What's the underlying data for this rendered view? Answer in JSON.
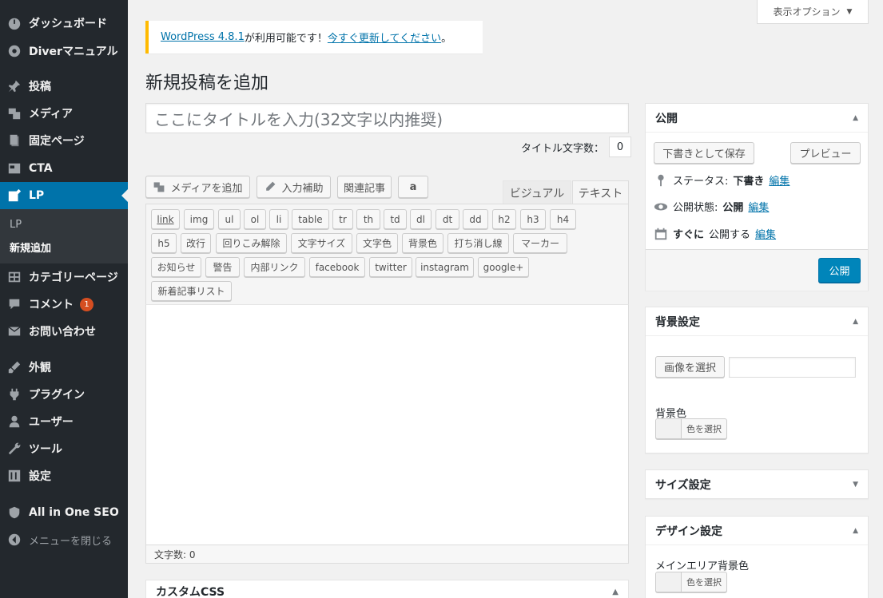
{
  "sidebar": {
    "items": [
      {
        "label": "ダッシュボード",
        "icon": "dashboard-icon"
      },
      {
        "label": "Diverマニュアル",
        "icon": "gear-icon"
      },
      {
        "label": "投稿",
        "icon": "pin-icon"
      },
      {
        "label": "メディア",
        "icon": "media-icon"
      },
      {
        "label": "固定ページ",
        "icon": "page-icon"
      },
      {
        "label": "CTA",
        "icon": "cta-icon"
      },
      {
        "label": "LP",
        "icon": "edit-icon"
      },
      {
        "label": "カテゴリーページ",
        "icon": "grid-icon"
      },
      {
        "label": "コメント",
        "icon": "comment-icon",
        "badge": "1"
      },
      {
        "label": "お問い合わせ",
        "icon": "mail-icon"
      },
      {
        "label": "外観",
        "icon": "brush-icon"
      },
      {
        "label": "プラグイン",
        "icon": "plugin-icon"
      },
      {
        "label": "ユーザー",
        "icon": "user-icon"
      },
      {
        "label": "ツール",
        "icon": "wrench-icon"
      },
      {
        "label": "設定",
        "icon": "settings-icon"
      },
      {
        "label": "All in One SEO",
        "icon": "shield-icon"
      },
      {
        "label": "メニューを閉じる",
        "icon": "collapse-icon"
      }
    ],
    "submenu": [
      "LP",
      "新規追加"
    ]
  },
  "screen_options": "表示オプション",
  "notice": {
    "link1": "WordPress 4.8.1",
    "middle": " が利用可能です！",
    "link2": "今すぐ更新してください",
    "end": "。"
  },
  "page_title": "新規投稿を追加",
  "title_placeholder": "ここにタイトルを入力(32文字以内推奨)",
  "title_count": {
    "label": "タイトル文字数：",
    "value": "0"
  },
  "toolbar": {
    "add_media": "メディアを追加",
    "input_assist": "入力補助",
    "related": "関連記事",
    "amazon": "a"
  },
  "tabs": {
    "visual": "ビジュアル",
    "text": "テキスト"
  },
  "quicktags": {
    "row1": [
      "link",
      "img",
      "ul",
      "ol",
      "li",
      "table",
      "tr",
      "th",
      "td",
      "dl",
      "dt",
      "dd",
      "h2",
      "h3",
      "h4"
    ],
    "row2": [
      "h5",
      "改行",
      "回りこみ解除",
      "文字サイズ",
      "文字色",
      "背景色",
      "打ち消し線",
      "マーカー"
    ],
    "row3": [
      "お知らせ",
      "警告",
      "内部リンク",
      "facebook",
      "twitter",
      "instagram",
      "google+"
    ],
    "row4": [
      "新着記事リスト"
    ]
  },
  "word_count": "文字数: 0",
  "custom_css": "カスタムCSS",
  "publish": {
    "title": "公開",
    "save_draft": "下書きとして保存",
    "preview": "プレビュー",
    "status_label": "ステータス:",
    "status_value": "下書き",
    "visibility_label": "公開状態:",
    "visibility_value": "公開",
    "schedule_bold": "すぐに",
    "schedule_rest": "公開する",
    "edit": "編集",
    "publish_btn": "公開"
  },
  "bg_settings": {
    "title": "背景設定",
    "choose_image": "画像を選択",
    "bg_color_label": "背景色",
    "choose_color": "色を選択"
  },
  "size_settings": {
    "title": "サイズ設定"
  },
  "design_settings": {
    "title": "デザイン設定",
    "main_bg_label": "メインエリア背景色",
    "choose_color": "色を選択"
  },
  "colors": {
    "accent": "#0073aa",
    "sidebar": "#23282d",
    "notice": "#ffba00",
    "badge": "#d54e21"
  }
}
